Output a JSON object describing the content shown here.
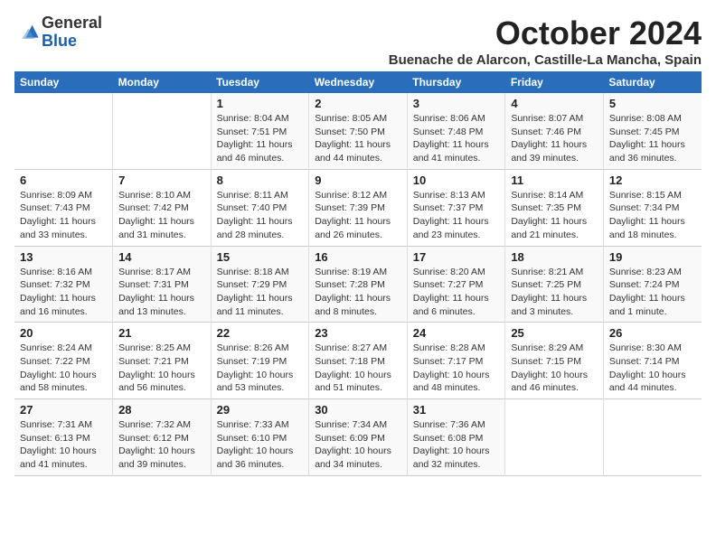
{
  "header": {
    "logo_general": "General",
    "logo_blue": "Blue",
    "month_title": "October 2024",
    "location": "Buenache de Alarcon, Castille-La Mancha, Spain"
  },
  "weekdays": [
    "Sunday",
    "Monday",
    "Tuesday",
    "Wednesday",
    "Thursday",
    "Friday",
    "Saturday"
  ],
  "weeks": [
    [
      {
        "day": "",
        "info": ""
      },
      {
        "day": "",
        "info": ""
      },
      {
        "day": "1",
        "info": "Sunrise: 8:04 AM\nSunset: 7:51 PM\nDaylight: 11 hours and 46 minutes."
      },
      {
        "day": "2",
        "info": "Sunrise: 8:05 AM\nSunset: 7:50 PM\nDaylight: 11 hours and 44 minutes."
      },
      {
        "day": "3",
        "info": "Sunrise: 8:06 AM\nSunset: 7:48 PM\nDaylight: 11 hours and 41 minutes."
      },
      {
        "day": "4",
        "info": "Sunrise: 8:07 AM\nSunset: 7:46 PM\nDaylight: 11 hours and 39 minutes."
      },
      {
        "day": "5",
        "info": "Sunrise: 8:08 AM\nSunset: 7:45 PM\nDaylight: 11 hours and 36 minutes."
      }
    ],
    [
      {
        "day": "6",
        "info": "Sunrise: 8:09 AM\nSunset: 7:43 PM\nDaylight: 11 hours and 33 minutes."
      },
      {
        "day": "7",
        "info": "Sunrise: 8:10 AM\nSunset: 7:42 PM\nDaylight: 11 hours and 31 minutes."
      },
      {
        "day": "8",
        "info": "Sunrise: 8:11 AM\nSunset: 7:40 PM\nDaylight: 11 hours and 28 minutes."
      },
      {
        "day": "9",
        "info": "Sunrise: 8:12 AM\nSunset: 7:39 PM\nDaylight: 11 hours and 26 minutes."
      },
      {
        "day": "10",
        "info": "Sunrise: 8:13 AM\nSunset: 7:37 PM\nDaylight: 11 hours and 23 minutes."
      },
      {
        "day": "11",
        "info": "Sunrise: 8:14 AM\nSunset: 7:35 PM\nDaylight: 11 hours and 21 minutes."
      },
      {
        "day": "12",
        "info": "Sunrise: 8:15 AM\nSunset: 7:34 PM\nDaylight: 11 hours and 18 minutes."
      }
    ],
    [
      {
        "day": "13",
        "info": "Sunrise: 8:16 AM\nSunset: 7:32 PM\nDaylight: 11 hours and 16 minutes."
      },
      {
        "day": "14",
        "info": "Sunrise: 8:17 AM\nSunset: 7:31 PM\nDaylight: 11 hours and 13 minutes."
      },
      {
        "day": "15",
        "info": "Sunrise: 8:18 AM\nSunset: 7:29 PM\nDaylight: 11 hours and 11 minutes."
      },
      {
        "day": "16",
        "info": "Sunrise: 8:19 AM\nSunset: 7:28 PM\nDaylight: 11 hours and 8 minutes."
      },
      {
        "day": "17",
        "info": "Sunrise: 8:20 AM\nSunset: 7:27 PM\nDaylight: 11 hours and 6 minutes."
      },
      {
        "day": "18",
        "info": "Sunrise: 8:21 AM\nSunset: 7:25 PM\nDaylight: 11 hours and 3 minutes."
      },
      {
        "day": "19",
        "info": "Sunrise: 8:23 AM\nSunset: 7:24 PM\nDaylight: 11 hours and 1 minute."
      }
    ],
    [
      {
        "day": "20",
        "info": "Sunrise: 8:24 AM\nSunset: 7:22 PM\nDaylight: 10 hours and 58 minutes."
      },
      {
        "day": "21",
        "info": "Sunrise: 8:25 AM\nSunset: 7:21 PM\nDaylight: 10 hours and 56 minutes."
      },
      {
        "day": "22",
        "info": "Sunrise: 8:26 AM\nSunset: 7:19 PM\nDaylight: 10 hours and 53 minutes."
      },
      {
        "day": "23",
        "info": "Sunrise: 8:27 AM\nSunset: 7:18 PM\nDaylight: 10 hours and 51 minutes."
      },
      {
        "day": "24",
        "info": "Sunrise: 8:28 AM\nSunset: 7:17 PM\nDaylight: 10 hours and 48 minutes."
      },
      {
        "day": "25",
        "info": "Sunrise: 8:29 AM\nSunset: 7:15 PM\nDaylight: 10 hours and 46 minutes."
      },
      {
        "day": "26",
        "info": "Sunrise: 8:30 AM\nSunset: 7:14 PM\nDaylight: 10 hours and 44 minutes."
      }
    ],
    [
      {
        "day": "27",
        "info": "Sunrise: 7:31 AM\nSunset: 6:13 PM\nDaylight: 10 hours and 41 minutes."
      },
      {
        "day": "28",
        "info": "Sunrise: 7:32 AM\nSunset: 6:12 PM\nDaylight: 10 hours and 39 minutes."
      },
      {
        "day": "29",
        "info": "Sunrise: 7:33 AM\nSunset: 6:10 PM\nDaylight: 10 hours and 36 minutes."
      },
      {
        "day": "30",
        "info": "Sunrise: 7:34 AM\nSunset: 6:09 PM\nDaylight: 10 hours and 34 minutes."
      },
      {
        "day": "31",
        "info": "Sunrise: 7:36 AM\nSunset: 6:08 PM\nDaylight: 10 hours and 32 minutes."
      },
      {
        "day": "",
        "info": ""
      },
      {
        "day": "",
        "info": ""
      }
    ]
  ]
}
